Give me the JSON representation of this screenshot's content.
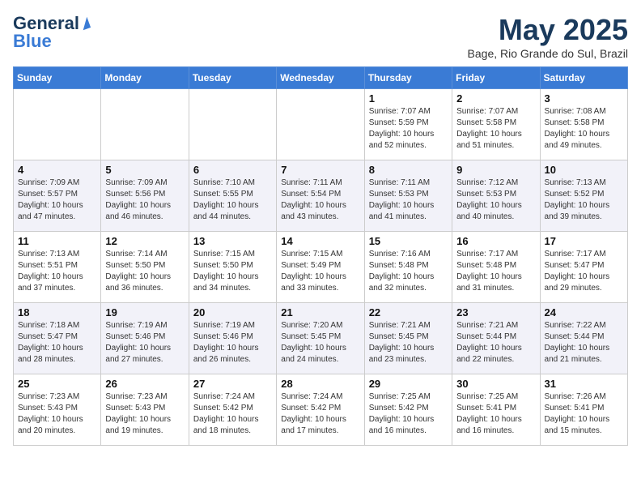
{
  "header": {
    "logo_general": "General",
    "logo_blue": "Blue",
    "month_title": "May 2025",
    "location": "Bage, Rio Grande do Sul, Brazil"
  },
  "weekdays": [
    "Sunday",
    "Monday",
    "Tuesday",
    "Wednesday",
    "Thursday",
    "Friday",
    "Saturday"
  ],
  "weeks": [
    [
      {
        "day": "",
        "empty": true
      },
      {
        "day": "",
        "empty": true
      },
      {
        "day": "",
        "empty": true
      },
      {
        "day": "",
        "empty": true
      },
      {
        "day": "1",
        "sunrise": "7:07 AM",
        "sunset": "5:59 PM",
        "daylight": "10 hours and 52 minutes."
      },
      {
        "day": "2",
        "sunrise": "7:07 AM",
        "sunset": "5:58 PM",
        "daylight": "10 hours and 51 minutes."
      },
      {
        "day": "3",
        "sunrise": "7:08 AM",
        "sunset": "5:58 PM",
        "daylight": "10 hours and 49 minutes."
      }
    ],
    [
      {
        "day": "4",
        "sunrise": "7:09 AM",
        "sunset": "5:57 PM",
        "daylight": "10 hours and 47 minutes."
      },
      {
        "day": "5",
        "sunrise": "7:09 AM",
        "sunset": "5:56 PM",
        "daylight": "10 hours and 46 minutes."
      },
      {
        "day": "6",
        "sunrise": "7:10 AM",
        "sunset": "5:55 PM",
        "daylight": "10 hours and 44 minutes."
      },
      {
        "day": "7",
        "sunrise": "7:11 AM",
        "sunset": "5:54 PM",
        "daylight": "10 hours and 43 minutes."
      },
      {
        "day": "8",
        "sunrise": "7:11 AM",
        "sunset": "5:53 PM",
        "daylight": "10 hours and 41 minutes."
      },
      {
        "day": "9",
        "sunrise": "7:12 AM",
        "sunset": "5:53 PM",
        "daylight": "10 hours and 40 minutes."
      },
      {
        "day": "10",
        "sunrise": "7:13 AM",
        "sunset": "5:52 PM",
        "daylight": "10 hours and 39 minutes."
      }
    ],
    [
      {
        "day": "11",
        "sunrise": "7:13 AM",
        "sunset": "5:51 PM",
        "daylight": "10 hours and 37 minutes."
      },
      {
        "day": "12",
        "sunrise": "7:14 AM",
        "sunset": "5:50 PM",
        "daylight": "10 hours and 36 minutes."
      },
      {
        "day": "13",
        "sunrise": "7:15 AM",
        "sunset": "5:50 PM",
        "daylight": "10 hours and 34 minutes."
      },
      {
        "day": "14",
        "sunrise": "7:15 AM",
        "sunset": "5:49 PM",
        "daylight": "10 hours and 33 minutes."
      },
      {
        "day": "15",
        "sunrise": "7:16 AM",
        "sunset": "5:48 PM",
        "daylight": "10 hours and 32 minutes."
      },
      {
        "day": "16",
        "sunrise": "7:17 AM",
        "sunset": "5:48 PM",
        "daylight": "10 hours and 31 minutes."
      },
      {
        "day": "17",
        "sunrise": "7:17 AM",
        "sunset": "5:47 PM",
        "daylight": "10 hours and 29 minutes."
      }
    ],
    [
      {
        "day": "18",
        "sunrise": "7:18 AM",
        "sunset": "5:47 PM",
        "daylight": "10 hours and 28 minutes."
      },
      {
        "day": "19",
        "sunrise": "7:19 AM",
        "sunset": "5:46 PM",
        "daylight": "10 hours and 27 minutes."
      },
      {
        "day": "20",
        "sunrise": "7:19 AM",
        "sunset": "5:46 PM",
        "daylight": "10 hours and 26 minutes."
      },
      {
        "day": "21",
        "sunrise": "7:20 AM",
        "sunset": "5:45 PM",
        "daylight": "10 hours and 24 minutes."
      },
      {
        "day": "22",
        "sunrise": "7:21 AM",
        "sunset": "5:45 PM",
        "daylight": "10 hours and 23 minutes."
      },
      {
        "day": "23",
        "sunrise": "7:21 AM",
        "sunset": "5:44 PM",
        "daylight": "10 hours and 22 minutes."
      },
      {
        "day": "24",
        "sunrise": "7:22 AM",
        "sunset": "5:44 PM",
        "daylight": "10 hours and 21 minutes."
      }
    ],
    [
      {
        "day": "25",
        "sunrise": "7:23 AM",
        "sunset": "5:43 PM",
        "daylight": "10 hours and 20 minutes."
      },
      {
        "day": "26",
        "sunrise": "7:23 AM",
        "sunset": "5:43 PM",
        "daylight": "10 hours and 19 minutes."
      },
      {
        "day": "27",
        "sunrise": "7:24 AM",
        "sunset": "5:42 PM",
        "daylight": "10 hours and 18 minutes."
      },
      {
        "day": "28",
        "sunrise": "7:24 AM",
        "sunset": "5:42 PM",
        "daylight": "10 hours and 17 minutes."
      },
      {
        "day": "29",
        "sunrise": "7:25 AM",
        "sunset": "5:42 PM",
        "daylight": "10 hours and 16 minutes."
      },
      {
        "day": "30",
        "sunrise": "7:25 AM",
        "sunset": "5:41 PM",
        "daylight": "10 hours and 16 minutes."
      },
      {
        "day": "31",
        "sunrise": "7:26 AM",
        "sunset": "5:41 PM",
        "daylight": "10 hours and 15 minutes."
      }
    ]
  ],
  "labels": {
    "sunrise": "Sunrise:",
    "sunset": "Sunset:",
    "daylight": "Daylight:"
  }
}
